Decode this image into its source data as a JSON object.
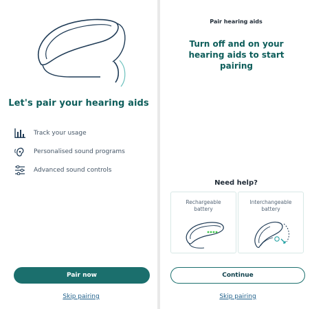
{
  "pair_intro": {
    "title": "Let's pair your hearing aids",
    "features": [
      {
        "icon": "bar-chart-icon",
        "label": "Track your usage"
      },
      {
        "icon": "ear-sound-icon",
        "label": "Personalised sound programs"
      },
      {
        "icon": "sliders-icon",
        "label": "Advanced sound controls"
      }
    ],
    "primary_button": "Pair now",
    "skip_link": "Skip pairing"
  },
  "pair_instructions": {
    "header": "Pair hearing aids",
    "instruction": "Turn off and on your hearing aids to start pairing",
    "help_title": "Need help?",
    "cards": [
      {
        "line1": "Rechargeable",
        "line2": "battery"
      },
      {
        "line1": "Interchangeable",
        "line2": "battery"
      }
    ],
    "continue_button": "Continue",
    "skip_link": "Skip pairing"
  },
  "colors": {
    "accent": "#1b6f6d",
    "title_teal": "#0d5d5a",
    "link": "#1e5f8a",
    "battery_indicator": "#3ec64b"
  }
}
